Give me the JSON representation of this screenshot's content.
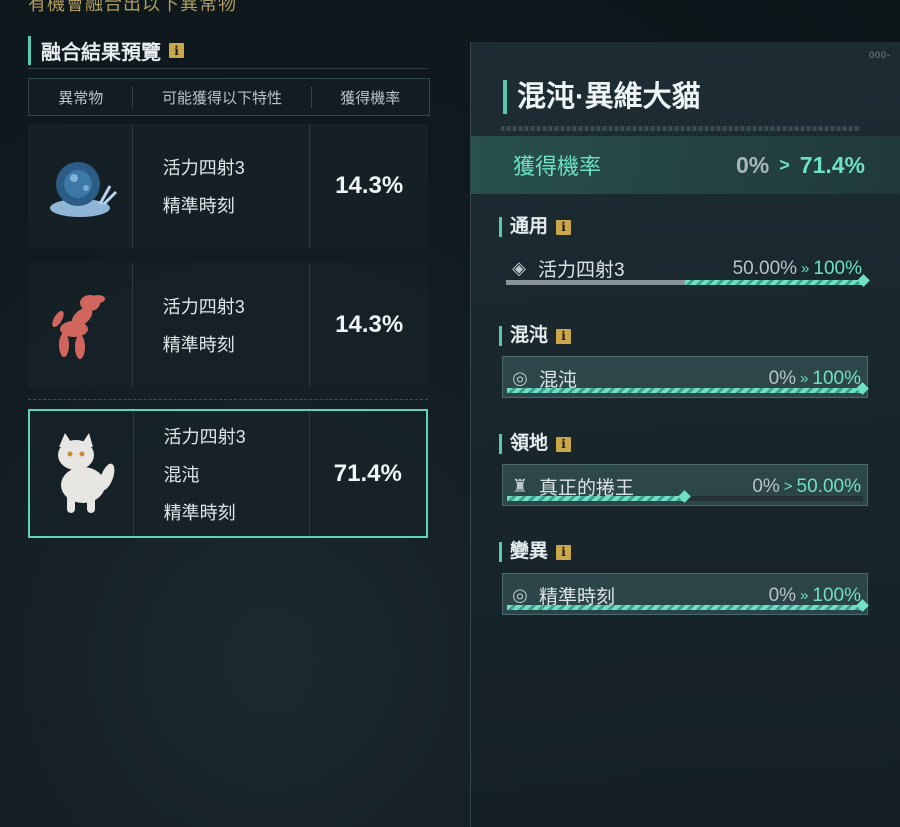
{
  "top_hint": "有機會融合出以下異常物",
  "left": {
    "title": "融合結果預覽",
    "info_icon": "info-icon",
    "headers": [
      "異常物",
      "可能獲得以下特性",
      "獲得機率"
    ],
    "rows": [
      {
        "icon": "blue-snail-icon",
        "traits": [
          "活力四射3",
          "精準時刻"
        ],
        "probability": "14.3%"
      },
      {
        "icon": "balloon-dog-icon",
        "traits": [
          "活力四射3",
          "精準時刻"
        ],
        "probability": "14.3%"
      },
      {
        "icon": "white-cat-icon",
        "traits": [
          "活力四射3",
          "混沌",
          "精準時刻"
        ],
        "probability": "71.4%",
        "selected": true
      }
    ]
  },
  "right": {
    "deco": "000-",
    "title": "混沌·異維大貓",
    "chance": {
      "label": "獲得機率",
      "from": "0%",
      "arrow": ">",
      "to": "71.4%"
    },
    "sections": [
      {
        "title": "通用",
        "trait": {
          "icon": "diamond-icon",
          "name": "活力四射3",
          "from": "50.00%",
          "arrow": "»",
          "to": "100%",
          "current": 0.5,
          "target": 1.0,
          "boxed": false
        }
      },
      {
        "title": "混沌",
        "trait": {
          "icon": "swirl-icon",
          "name": "混沌",
          "from": "0%",
          "arrow": "»",
          "to": "100%",
          "current": 0,
          "target": 1.0,
          "boxed": true
        }
      },
      {
        "title": "領地",
        "trait": {
          "icon": "robe-icon",
          "name": "真正的捲王",
          "from": "0%",
          "arrow": ">",
          "to": "50.00%",
          "current": 0,
          "target": 0.5,
          "boxed": true
        }
      },
      {
        "title": "變異",
        "trait": {
          "icon": "swirl-icon",
          "name": "精準時刻",
          "from": "0%",
          "arrow": "»",
          "to": "100%",
          "current": 0,
          "target": 1.0,
          "boxed": true
        }
      }
    ]
  },
  "colors": {
    "accent": "#5fd3bd",
    "info": "#c9a74a"
  }
}
